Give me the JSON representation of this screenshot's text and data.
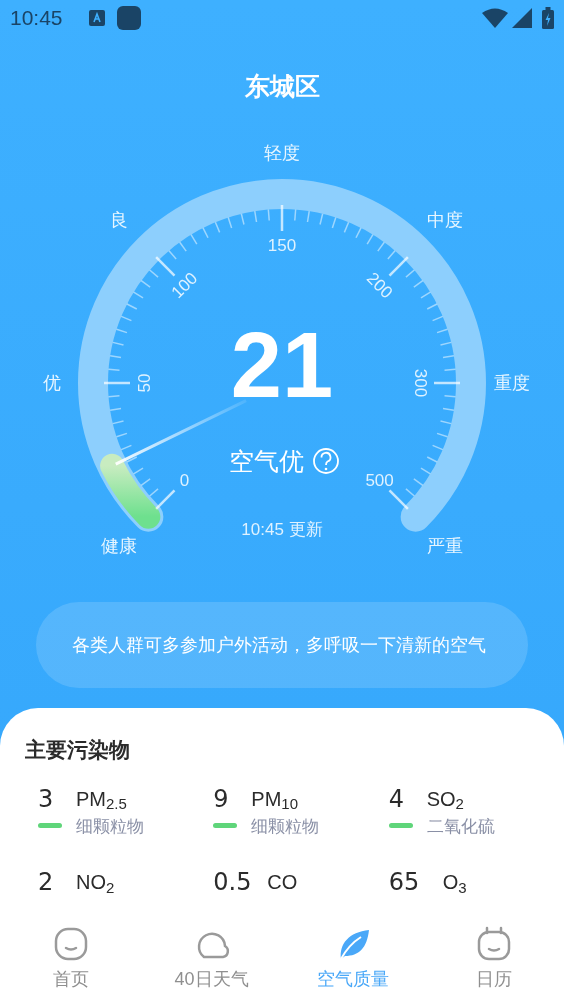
{
  "status_bar": {
    "time": "10:45"
  },
  "title": "东城区",
  "gauge": {
    "value": "21",
    "status": "空气优",
    "updated": "10:45 更新",
    "scale_labels": [
      "0",
      "50",
      "100",
      "150",
      "200",
      "300",
      "500"
    ],
    "category_labels": [
      "健康",
      "优",
      "良",
      "轻度",
      "中度",
      "重度",
      "严重"
    ]
  },
  "advice": "各类人群可多参加户外活动，多呼吸一下清新的空气",
  "pollutants": {
    "title": "主要污染物",
    "items": [
      {
        "value": "3",
        "name": "PM$_{2.5}$",
        "desc": "细颗粒物",
        "color": "#5fd57a"
      },
      {
        "value": "9",
        "name": "PM$_{10}$",
        "desc": "细颗粒物",
        "color": "#5fd57a"
      },
      {
        "value": "4",
        "name": "SO$_{2}$",
        "desc": "二氧化硫",
        "color": "#5fd57a"
      },
      {
        "value": "2",
        "name": "NO$_{2}$"
      },
      {
        "value": "0.5",
        "name": "CO"
      },
      {
        "value": "65",
        "name": "O$_{3}$"
      }
    ]
  },
  "nav": [
    {
      "label": "首页",
      "kind": "home",
      "selected": false
    },
    {
      "label": "40日天气",
      "kind": "weather",
      "selected": false
    },
    {
      "label": "空气质量",
      "kind": "air",
      "selected": true
    },
    {
      "label": "日历",
      "kind": "calendar",
      "selected": false
    }
  ]
}
